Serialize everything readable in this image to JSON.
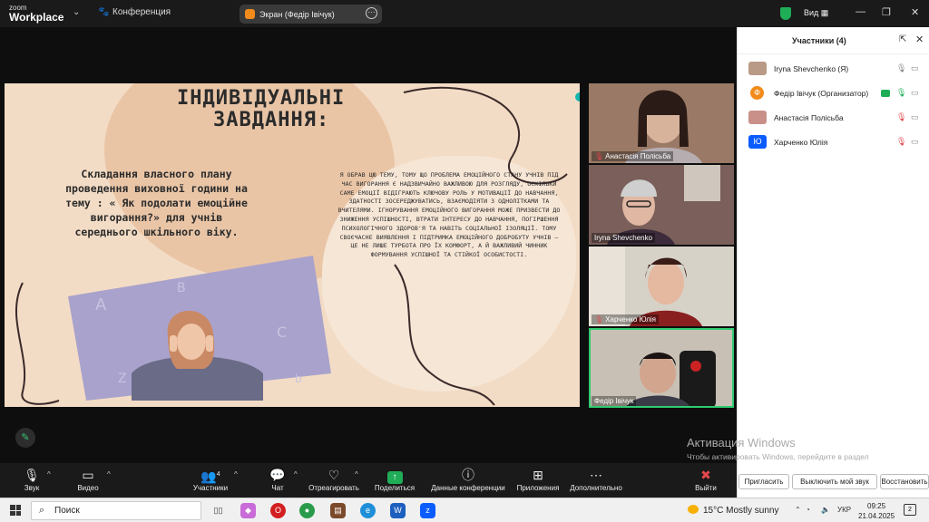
{
  "topbar": {
    "logo_line1": "zoom",
    "logo_line2": "Workplace",
    "conference_label": "Конференция",
    "screen_share_label": "Экран (Федір Івічук)",
    "view_label": "Вид"
  },
  "slide": {
    "title_line1": "ІНДИВІДУАЛЬНІ",
    "title_line2": "ЗАВДАННЯ:",
    "left_text": "Складання власного плану проведення виховної години на тему : « Як подолати емоційне вигорання?»  для учнів середнього шкільного віку.",
    "right_text": "Я ОБРАВ ЦЮ ТЕМУ, ТОМУ ЩО ПРОБЛЕМА ЕМОЦІЙНОГО СТАНУ УЧНІВ ПІД ЧАС ВИГОРАННЯ Є НАДЗВИЧАЙНО ВАЖЛИВОЮ ДЛЯ РОЗГЛЯДУ, ОСКІЛЬКИ САМЕ ЕМОЦІЇ ВІДІГРАЮТЬ КЛЮЧОВУ РОЛЬ У МОТИВАЦІЇ ДО НАВЧАННЯ, ЗДАТНОСТІ ЗОСЕРЕДЖУВАТИСЬ, ВЗАЄМОДІЯТИ З ОДНОЛІТКАМИ ТА ВЧИТЕЛЯМИ. ІГНОРУВАННЯ ЕМОЦІЙНОГО ВИГОРАННЯ МОЖЕ ПРИЗВЕСТИ ДО ЗНИЖЕННЯ УСПІШНОСТІ, ВТРАТИ ІНТЕРЕСУ ДО НАВЧАННЯ, ПОГІРШЕННЯ ПСИХОЛОГІЧНОГО ЗДОРОВ'Я ТА НАВІТЬ СОЦІАЛЬНОЇ ІЗОЛЯЦІЇ. ТОМУ СВОЄЧАСНЕ ВИЯВЛЕННЯ І ПІДТРИМКА ЕМОЦІЙНОГО ДОБРОБУТУ УЧНІВ — ЦЕ НЕ ЛИШЕ ТУРБОТА ПРО ЇХ КОМФОРТ, А Й ВАЖЛИВИЙ ЧИННИК ФОРМУВАННЯ УСПІШНОЇ ТА СТІЙКОЇ ОСОБИСТОСТІ."
  },
  "video_tiles": [
    {
      "name": "Анастасія Полісьба",
      "muted": true
    },
    {
      "name": "Iryna Shevchenko",
      "muted": false
    },
    {
      "name": "Харченко Юлія",
      "muted": true
    },
    {
      "name": "Федір Івічук",
      "muted": false,
      "active": true
    }
  ],
  "participants_panel": {
    "title": "Участники (4)",
    "rows": [
      {
        "name": "Iryna Shevchenko (Я)",
        "avatar": ""
      },
      {
        "name": "Федір Івічук (Организатор)",
        "avatar": "Ф"
      },
      {
        "name": "Анастасія Полісьба",
        "avatar": ""
      },
      {
        "name": "Харченко Юлія",
        "avatar": "Ю"
      }
    ],
    "buttons": {
      "invite": "Пригласить",
      "mute_me": "Выключить мой звук",
      "restore": "Восстановить"
    }
  },
  "watermark": {
    "line1": "Активация Windows",
    "line2": "Чтобы активировать Windows, перейдите в раздел \"Параметры\"."
  },
  "toolbar": {
    "audio": "Звук",
    "video": "Видео",
    "participants": "Участники",
    "participants_count": "4",
    "chat": "Чат",
    "react": "Отреагировать",
    "share": "Поделиться",
    "meeting_data": "Данные конференции",
    "apps": "Приложения",
    "more": "Дополнительно",
    "leave": "Выйти"
  },
  "taskbar": {
    "search_placeholder": "Поиск",
    "weather": "15°C  Mostly sunny",
    "lang": "УКР",
    "time": "09:25",
    "date": "21.04.2025",
    "notifications": "2"
  },
  "colors": {
    "accent_green": "#1fae57",
    "zoom_blue": "#0b5cff",
    "slide_bg": "#f3dcc5",
    "org_avatar": "#f28b1a"
  }
}
